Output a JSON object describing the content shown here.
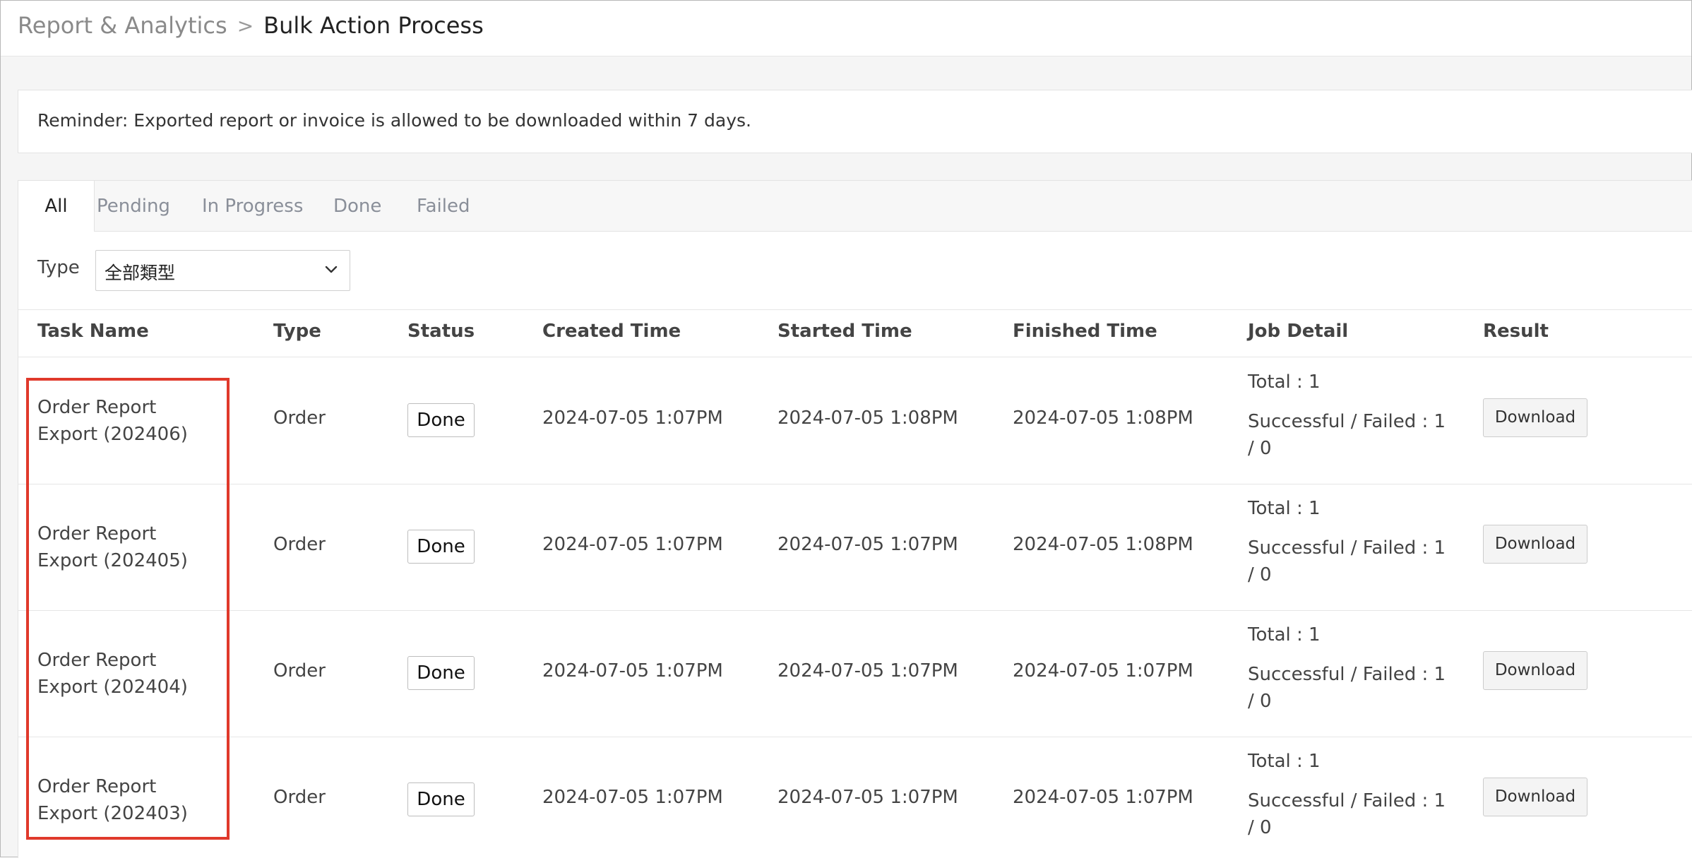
{
  "breadcrumb": {
    "parent": "Report & Analytics",
    "separator": ">",
    "current": "Bulk Action Process"
  },
  "reminder": {
    "text": "Reminder: Exported report or invoice is allowed to be downloaded within 7 days."
  },
  "tabs": [
    {
      "label": "All",
      "active": true
    },
    {
      "label": "Pending",
      "active": false
    },
    {
      "label": "In Progress",
      "active": false
    },
    {
      "label": "Done",
      "active": false
    },
    {
      "label": "Failed",
      "active": false
    }
  ],
  "filter": {
    "label": "Type",
    "selected": "全部類型",
    "icon": "chevron-down-icon"
  },
  "table": {
    "headers": [
      "Task Name",
      "Type",
      "Status",
      "Created Time",
      "Started Time",
      "Finished Time",
      "Job Detail",
      "Result"
    ],
    "rows": [
      {
        "task_name": "Order Report Export (202406)",
        "type": "Order",
        "status": "Done",
        "created": "2024-07-05 1:07PM",
        "started": "2024-07-05 1:08PM",
        "finished": "2024-07-05 1:08PM",
        "job_total": "Total : 1",
        "job_success": "Successful / Failed : 1 / 0",
        "result_label": "Download"
      },
      {
        "task_name": "Order Report Export (202405)",
        "type": "Order",
        "status": "Done",
        "created": "2024-07-05 1:07PM",
        "started": "2024-07-05 1:07PM",
        "finished": "2024-07-05 1:08PM",
        "job_total": "Total : 1",
        "job_success": "Successful / Failed : 1 / 0",
        "result_label": "Download"
      },
      {
        "task_name": "Order Report Export (202404)",
        "type": "Order",
        "status": "Done",
        "created": "2024-07-05 1:07PM",
        "started": "2024-07-05 1:07PM",
        "finished": "2024-07-05 1:07PM",
        "job_total": "Total : 1",
        "job_success": "Successful / Failed : 1 / 0",
        "result_label": "Download"
      },
      {
        "task_name": "Order Report Export (202403)",
        "type": "Order",
        "status": "Done",
        "created": "2024-07-05 1:07PM",
        "started": "2024-07-05 1:07PM",
        "finished": "2024-07-05 1:07PM",
        "job_total": "Total : 1",
        "job_success": "Successful / Failed : 1 / 0",
        "result_label": "Download"
      }
    ]
  },
  "colors": {
    "highlight": "#e0392b",
    "page_background": "#f5f5f5",
    "panel_background": "#ffffff"
  }
}
